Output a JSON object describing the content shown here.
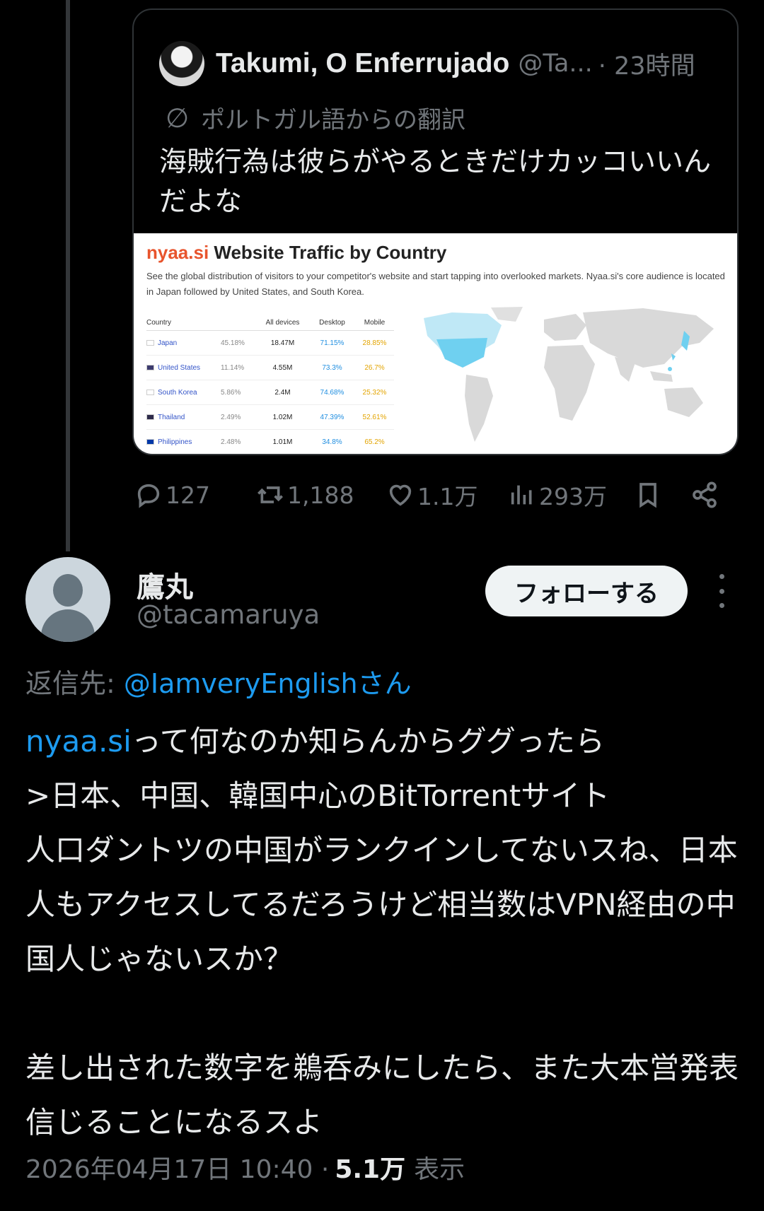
{
  "quoted_tweet": {
    "author_name": "Takumi, O Enferrujado",
    "author_handle": "@Ta...",
    "time": "· 23時間",
    "translation_label": "ポルトガル語からの翻訳",
    "text": "海賊行為は彼らがやるときだけカッコいいんだよな",
    "image": {
      "brand": "nyaa.si",
      "title": " Website Traffic by Country",
      "description": "See the global distribution of visitors to your competitor's website and start tapping into overlooked markets. Nyaa.si's core audience is located in Japan followed by United States, and South Korea.",
      "headers": {
        "country": "Country",
        "all": "All devices",
        "desktop": "Desktop",
        "mobile": "Mobile"
      },
      "rows": [
        {
          "country": "Japan",
          "pct": "45.18%",
          "all": "18.47M",
          "desktop": "71.15%",
          "mobile": "28.85%"
        },
        {
          "country": "United States",
          "pct": "11.14%",
          "all": "4.55M",
          "desktop": "73.3%",
          "mobile": "26.7%"
        },
        {
          "country": "South Korea",
          "pct": "5.86%",
          "all": "2.4M",
          "desktop": "74.68%",
          "mobile": "25.32%"
        },
        {
          "country": "Thailand",
          "pct": "2.49%",
          "all": "1.02M",
          "desktop": "47.39%",
          "mobile": "52.61%"
        },
        {
          "country": "Philippines",
          "pct": "2.48%",
          "all": "1.01M",
          "desktop": "34.8%",
          "mobile": "65.2%"
        }
      ]
    },
    "actions": {
      "replies": "127",
      "reposts": "1,188",
      "likes": "1.1万",
      "views": "293万"
    }
  },
  "post": {
    "author_name": "鷹丸",
    "author_handle": "@tacamaruya",
    "follow_label": "フォローする",
    "reply_prefix": "返信先: ",
    "reply_mention": "@IamveryEnglish",
    "reply_suffix": "さん",
    "link_text": "nyaa.si",
    "body_rest": "って何なのか知らんからググったら\n>日本、中国、韓国中心のBitTorrentサイト\n人口ダントツの中国がランクインしてないスね、日本人もアクセスしてるだろうけど相当数はVPN経由の中国人じゃないスか？\n\n差し出された数字を鵜呑みにしたら、また大本営発表信じることになるスよ",
    "timestamp": "2026年04月17日 10:40 ·",
    "views": "5.1万",
    "views_label": "表示"
  },
  "colors": {
    "background": "#000000",
    "text": "#e7e9ea",
    "muted": "#71767b",
    "accent": "#1d9bf0",
    "border": "#2f3336"
  },
  "icons": [
    "reply-icon",
    "repost-icon",
    "like-icon",
    "views-icon",
    "bookmark-icon",
    "share-icon",
    "translate-icon",
    "more-icon"
  ]
}
